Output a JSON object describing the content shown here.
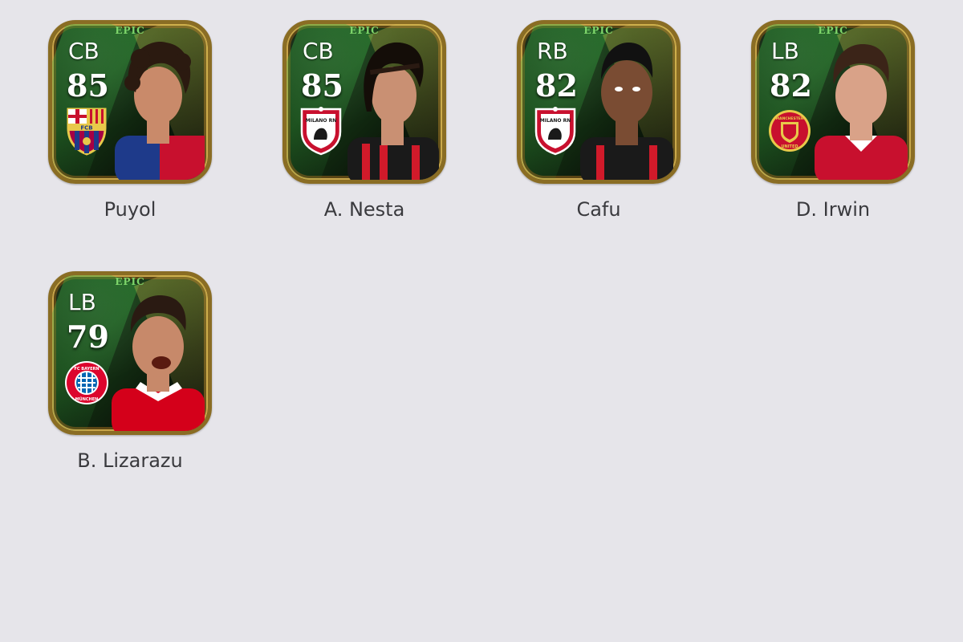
{
  "players": [
    {
      "position": "CB",
      "rating": "85",
      "name": "Puyol",
      "tier": "EPIC",
      "crest": "fc-barcelona-crest-icon",
      "kit_primary": "#c8102e",
      "kit_secondary": "#1e3a8a",
      "skin": "#c98a6a",
      "hair": "#2b1a10"
    },
    {
      "position": "CB",
      "rating": "85",
      "name": "A. Nesta",
      "tier": "EPIC",
      "crest": "milano-crest-icon",
      "kit_primary": "#1a1a1a",
      "kit_secondary": "#d11a2a",
      "skin": "#c99073",
      "hair": "#140d08"
    },
    {
      "position": "RB",
      "rating": "82",
      "name": "Cafu",
      "tier": "EPIC",
      "crest": "milano-crest-icon",
      "kit_primary": "#1a1a1a",
      "kit_secondary": "#d11a2a",
      "skin": "#7a4c33",
      "hair": "#111111"
    },
    {
      "position": "LB",
      "rating": "82",
      "name": "D. Irwin",
      "tier": "EPIC",
      "crest": "manchester-united-crest-icon",
      "kit_primary": "#c8102e",
      "kit_secondary": "#ffffff",
      "skin": "#d9a288",
      "hair": "#3b2418"
    },
    {
      "position": "LB",
      "rating": "79",
      "name": "B. Lizarazu",
      "tier": "EPIC",
      "crest": "fc-bayern-crest-icon",
      "kit_primary": "#d4001a",
      "kit_secondary": "#ffffff",
      "skin": "#c7896a",
      "hair": "#2a1a12"
    }
  ],
  "crests": {
    "barcelona_letters": "FCB",
    "milano_text": "MILANO RN",
    "manutd_top": "MANCHESTER",
    "manutd_bottom": "UNITED",
    "bayern_top": "FC BAYERN",
    "bayern_bottom": "MÜNCHEN"
  }
}
